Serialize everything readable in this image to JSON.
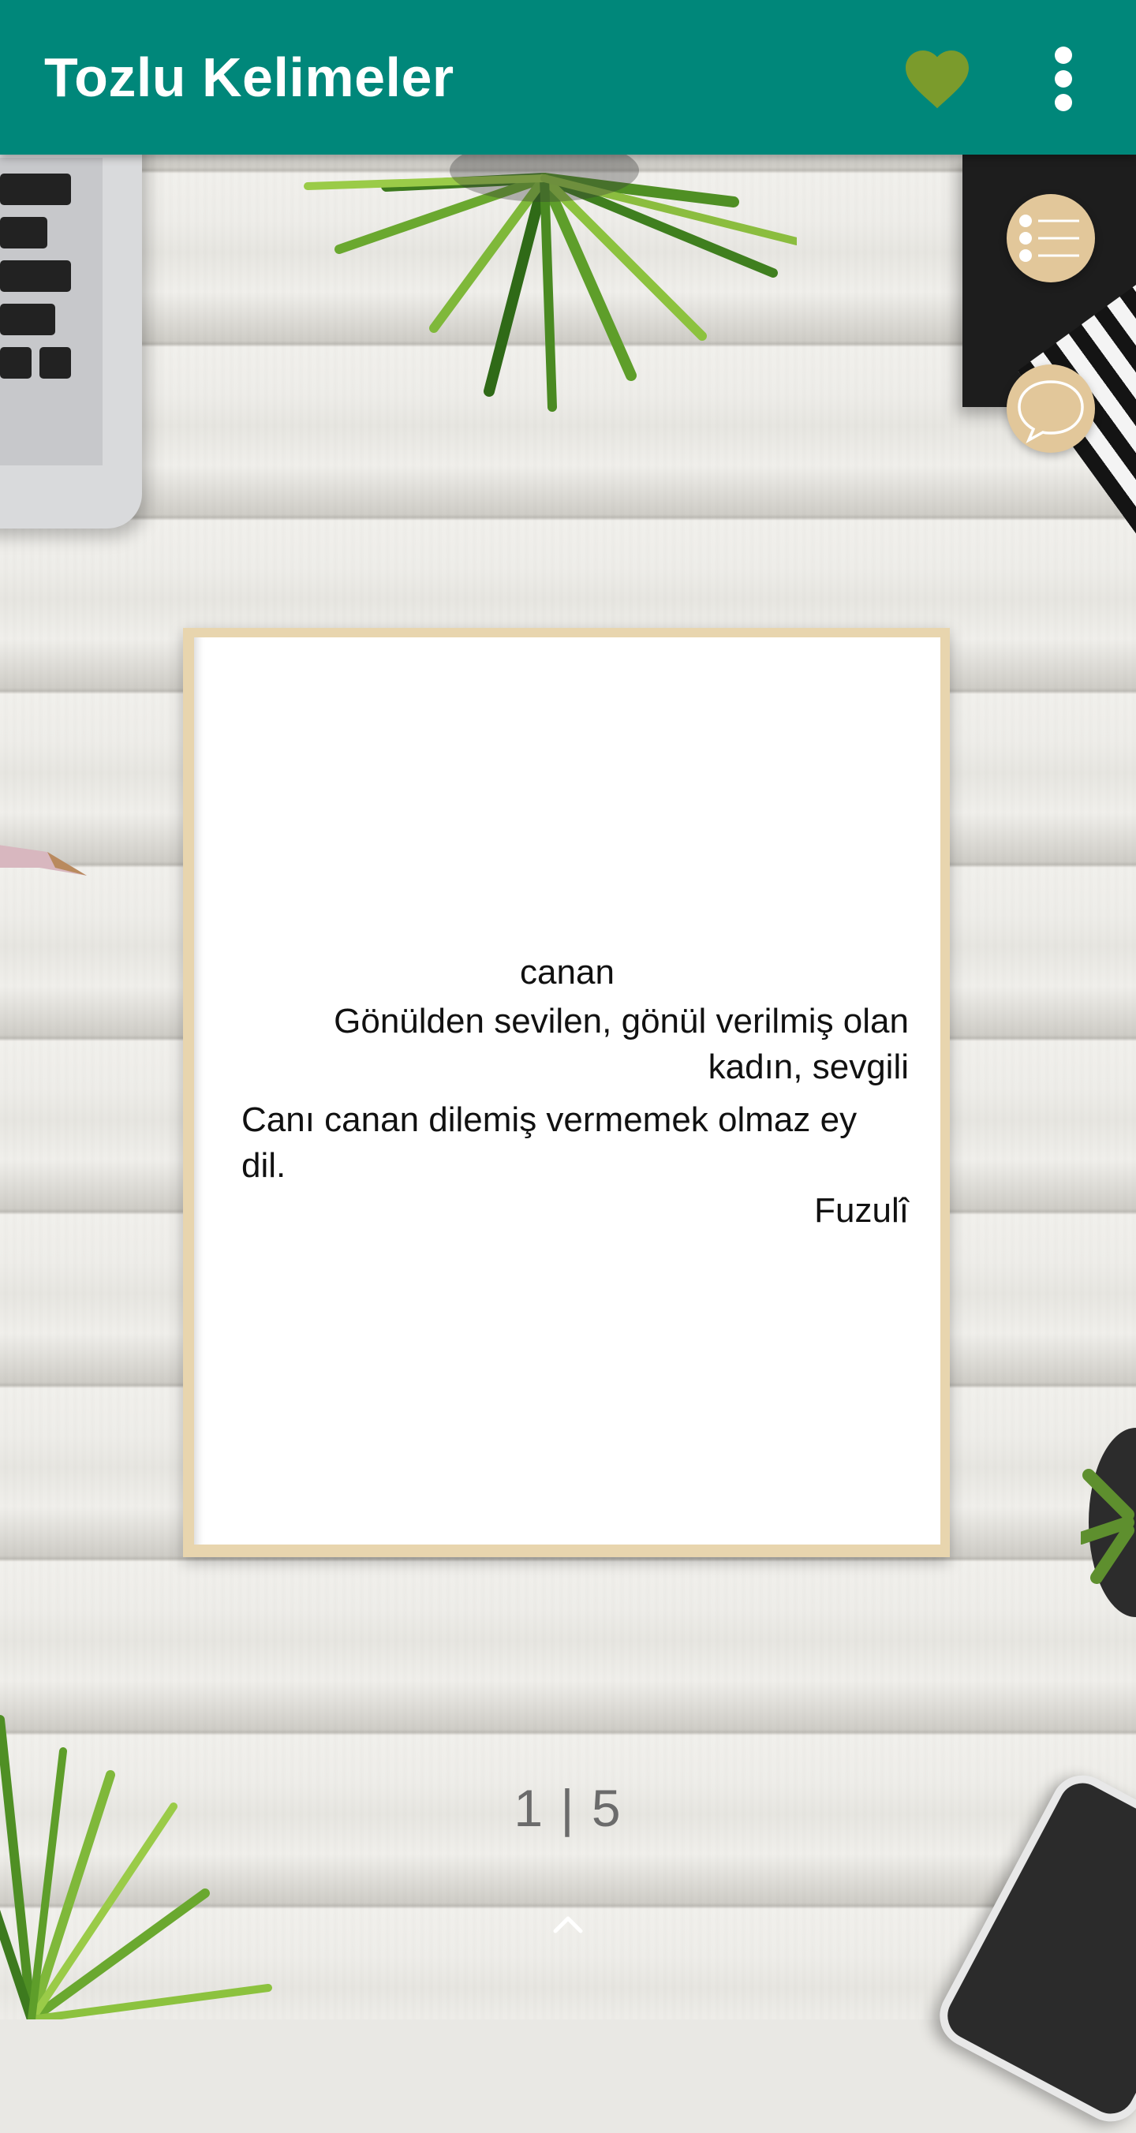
{
  "app_bar": {
    "title": "Tozlu Kelimeler",
    "favorite_icon": "heart-icon",
    "menu_icon": "more-vert-icon",
    "background_color": "#00877A",
    "favorite_color": "#7B9B2C"
  },
  "side_actions": [
    {
      "icon": "list-icon"
    },
    {
      "icon": "chat-bubble-icon"
    }
  ],
  "card": {
    "word": "canan",
    "definition": "Gönülden sevilen, gönül verilmiş olan kadın, sevgili",
    "example": "Canı canan dilemiş vermemek olmaz ey dil.",
    "author": "Fuzulî"
  },
  "pagination": {
    "current": "1",
    "separator": "|",
    "total": "5"
  },
  "bottom": {
    "expand_icon": "chevron-up-icon"
  }
}
